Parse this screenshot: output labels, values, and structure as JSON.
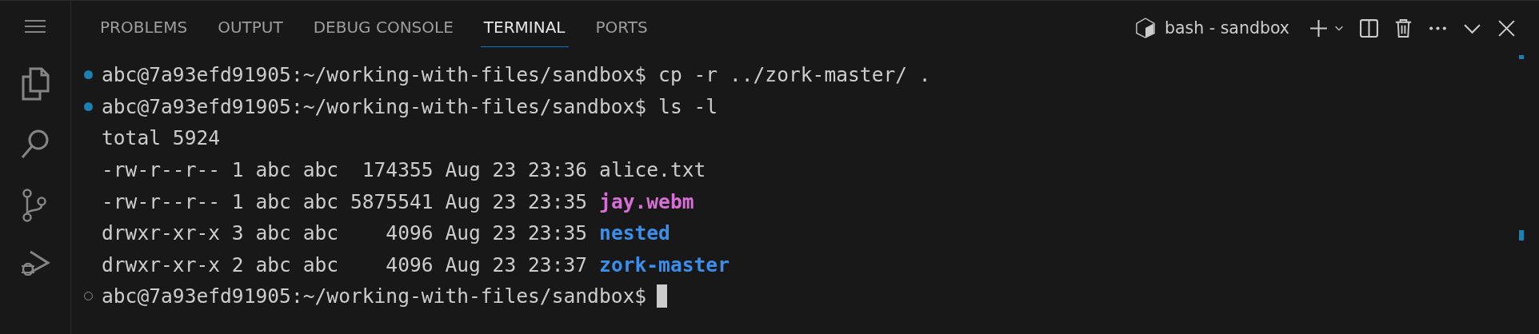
{
  "tabs": [
    {
      "label": "PROBLEMS",
      "selected": false
    },
    {
      "label": "OUTPUT",
      "selected": false
    },
    {
      "label": "DEBUG CONSOLE",
      "selected": false
    },
    {
      "label": "TERMINAL",
      "selected": true
    },
    {
      "label": "PORTS",
      "selected": false
    }
  ],
  "terminal_name": "bash - sandbox",
  "lines": [
    {
      "kind": "prompt",
      "done": true,
      "prompt": "abc@7a93efd91905:~/working-with-files/sandbox$",
      "command": "cp -r ../zork-master/ .",
      "cursor": false
    },
    {
      "kind": "prompt",
      "done": true,
      "prompt": "abc@7a93efd91905:~/working-with-files/sandbox$",
      "command": "ls -l",
      "cursor": false
    },
    {
      "kind": "output",
      "text": "total 5924"
    },
    {
      "kind": "entry",
      "text": "-rw-r--r-- 1 abc abc  174355 Aug 23 23:36",
      "name": "alice.txt",
      "color": "#cccccc",
      "bold": false
    },
    {
      "kind": "entry",
      "text": "-rw-r--r-- 1 abc abc 5875541 Aug 23 23:35",
      "name": "jay.webm",
      "color": "#d670d6",
      "bold": true
    },
    {
      "kind": "entry",
      "text": "drwxr-xr-x 3 abc abc    4096 Aug 23 23:35",
      "name": "nested",
      "color": "#3b8eea",
      "bold": true
    },
    {
      "kind": "entry",
      "text": "drwxr-xr-x 2 abc abc    4096 Aug 23 23:37",
      "name": "zork-master",
      "color": "#3b8eea",
      "bold": true
    },
    {
      "kind": "prompt",
      "done": false,
      "prompt": "abc@7a93efd91905:~/working-with-files/sandbox$",
      "cursor": true
    }
  ]
}
